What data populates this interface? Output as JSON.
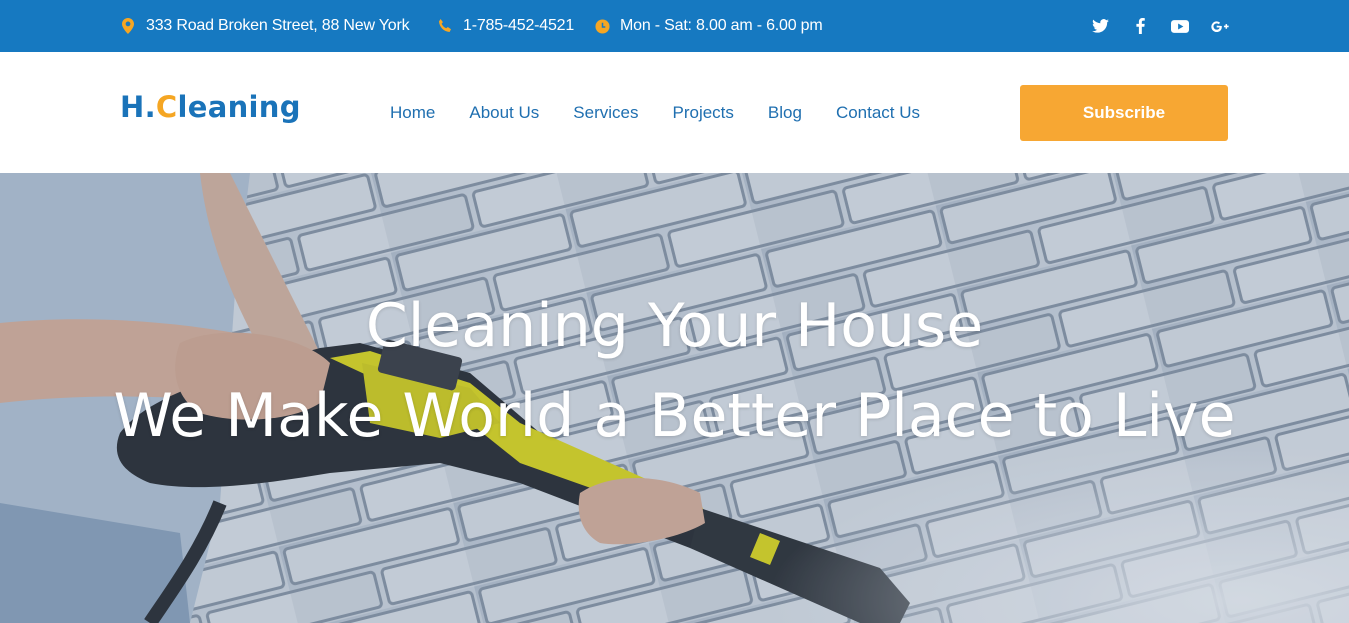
{
  "topbar": {
    "address": "333 Road Broken Street, 88 New York",
    "phone": "1-785-452-4521",
    "hours": "Mon - Sat: 8.00 am - 6.00 pm",
    "icons": {
      "address": "map-pin-icon",
      "phone": "phone-icon",
      "hours": "clock-icon"
    },
    "socials": [
      "twitter-icon",
      "facebook-icon",
      "youtube-icon",
      "google-plus-icon"
    ]
  },
  "header": {
    "logo_main": "H.",
    "logo_accent": "C",
    "logo_rest": "leaning",
    "nav": [
      {
        "label": "Home"
      },
      {
        "label": "About Us"
      },
      {
        "label": "Services"
      },
      {
        "label": "Projects"
      },
      {
        "label": "Blog"
      },
      {
        "label": "Contact Us"
      }
    ],
    "subscribe_label": "Subscribe"
  },
  "hero": {
    "line1": "Cleaning Your House",
    "line2": "We Make World a Better Place to Live"
  },
  "colors": {
    "topbar": "#1679c1",
    "brand_blue": "#1a73b9",
    "accent_orange": "#f5a623",
    "button_orange": "#f7a733"
  }
}
